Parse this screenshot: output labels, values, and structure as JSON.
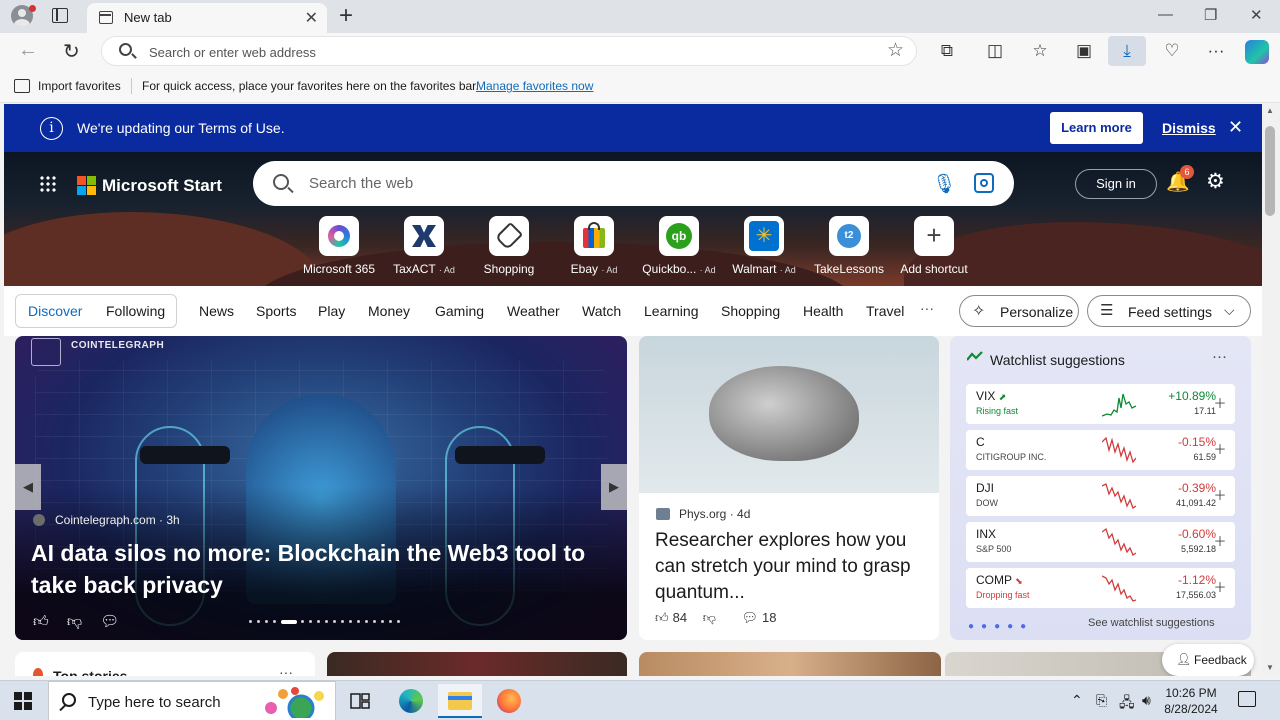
{
  "browser": {
    "tab_title": "New tab",
    "address_placeholder": "Search or enter web address"
  },
  "favorites_bar": {
    "import_label": "Import favorites",
    "message": "For quick access, place your favorites here on the favorites bar.",
    "manage_link": "Manage favorites now"
  },
  "terms_banner": {
    "message": "We're updating our Terms of Use.",
    "learn_more": "Learn more",
    "dismiss": "Dismiss"
  },
  "header": {
    "brand": "Microsoft Start",
    "search_placeholder": "Search the web",
    "sign_in": "Sign in",
    "notification_count": "6"
  },
  "quick_links": [
    {
      "label": "Microsoft 365",
      "ad": ""
    },
    {
      "label": "TaxACT",
      "ad": "· Ad"
    },
    {
      "label": "Shopping",
      "ad": ""
    },
    {
      "label": "Ebay",
      "ad": "· Ad"
    },
    {
      "label": "Quickbo...",
      "ad": "· Ad"
    },
    {
      "label": "Walmart",
      "ad": "· Ad"
    },
    {
      "label": "TakeLessons",
      "ad": ""
    },
    {
      "label": "Add shortcut",
      "ad": ""
    }
  ],
  "nav": {
    "discover": "Discover",
    "following": "Following",
    "links": [
      "News",
      "Sports",
      "Play",
      "Money",
      "Gaming",
      "Weather",
      "Watch",
      "Learning",
      "Shopping",
      "Health",
      "Travel"
    ],
    "more": "···",
    "personalize": "Personalize",
    "feed_settings": "Feed settings"
  },
  "main_story": {
    "brand": "COINTELEGRAPH",
    "source": "Cointelegraph.com · 3h",
    "headline": "AI data silos no more: Blockchain the Web3 tool to take back privacy"
  },
  "second_story": {
    "source": "Phys.org · 4d",
    "headline": "Researcher explores how you can stretch your mind to grasp quantum...",
    "likes": "84",
    "comments": "18"
  },
  "watchlist": {
    "title": "Watchlist suggestions",
    "more": "···",
    "see_all": "See watchlist suggestions",
    "rows": [
      {
        "symbol": "VIX",
        "name": "Rising fast",
        "change": "+10.89%",
        "price": "17.11",
        "trend": "up"
      },
      {
        "symbol": "C",
        "name": "CITIGROUP INC.",
        "change": "-0.15%",
        "price": "61.59",
        "trend": "down"
      },
      {
        "symbol": "DJI",
        "name": "DOW",
        "change": "-0.39%",
        "price": "41,091.42",
        "trend": "down"
      },
      {
        "symbol": "INX",
        "name": "S&P 500",
        "change": "-0.60%",
        "price": "5,592.18",
        "trend": "down"
      },
      {
        "symbol": "COMP",
        "name": "Dropping fast",
        "change": "-1.12%",
        "price": "17,556.03",
        "trend": "down"
      }
    ]
  },
  "feed_row2": {
    "top_stories": "Top stories",
    "feedback": "Feedback"
  },
  "taskbar": {
    "search_placeholder": "Type here to search",
    "time": "10:26 PM",
    "date": "8/28/2024"
  },
  "colors": {
    "accent": "#0f6cbd",
    "banner": "#0a2ba0",
    "positive": "#0d8a34",
    "negative": "#d03b3b"
  }
}
